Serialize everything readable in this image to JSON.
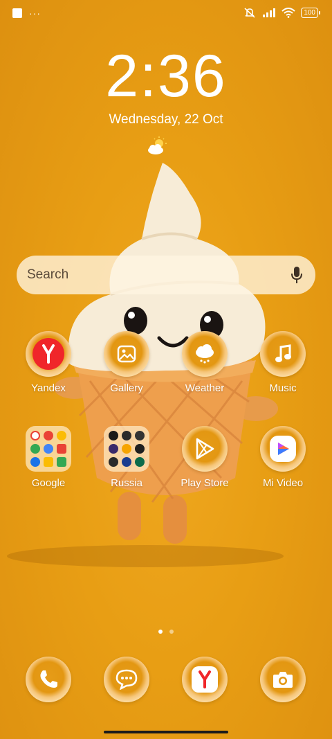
{
  "status_bar": {
    "battery": "100"
  },
  "lockscreen": {
    "time": "2:36",
    "date": "Wednesday, 22 Oct"
  },
  "search": {
    "placeholder": "Search"
  },
  "apps": [
    {
      "label": "Yandex"
    },
    {
      "label": "Gallery"
    },
    {
      "label": "Weather"
    },
    {
      "label": "Music"
    },
    {
      "label": "Google"
    },
    {
      "label": "Russia"
    },
    {
      "label": "Play Store"
    },
    {
      "label": "Mi Video"
    }
  ],
  "dock": [
    {
      "icon": "phone-icon"
    },
    {
      "icon": "messages-icon"
    },
    {
      "icon": "yandex-browser-icon"
    },
    {
      "icon": "camera-icon"
    }
  ],
  "colors": {
    "background": "#e89e14",
    "accent": "#f0262a"
  }
}
